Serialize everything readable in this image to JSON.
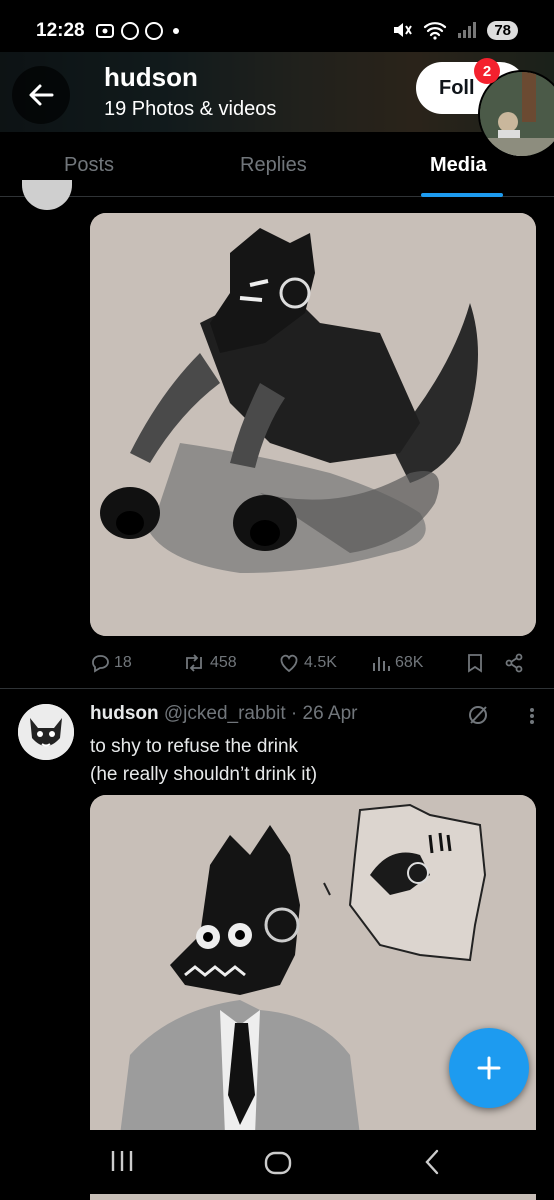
{
  "status_bar": {
    "time": "12:28",
    "battery": "78"
  },
  "header": {
    "name": "hudson",
    "subtitle": "19 Photos & videos",
    "follow_label": "Foll",
    "notification_count": "2"
  },
  "tabs": [
    {
      "label": "Posts",
      "active": false
    },
    {
      "label": "Replies",
      "active": false
    },
    {
      "label": "Media",
      "active": true
    }
  ],
  "post1": {
    "actions": {
      "replies": "18",
      "reposts": "458",
      "likes": "4.5K",
      "views": "68K"
    }
  },
  "post2": {
    "name": "hudson",
    "handle": "@jcked_rabbit",
    "dot": "·",
    "date": "26 Apr",
    "text_line1": "to shy to refuse the drink",
    "text_line2": "(he really shouldn’t drink it)"
  },
  "colors": {
    "accent": "#1d9bf0",
    "background": "#000000",
    "muted": "#71767b",
    "badge": "#f4212e",
    "artwork_bg": "#c8bfb8"
  },
  "icons": [
    "back-arrow-icon",
    "reply-icon",
    "repost-icon",
    "like-icon",
    "views-icon",
    "bookmark-icon",
    "share-icon",
    "grok-icon",
    "more-icon",
    "compose-plus-icon",
    "nav-recents-icon",
    "nav-home-icon",
    "nav-back-icon"
  ]
}
